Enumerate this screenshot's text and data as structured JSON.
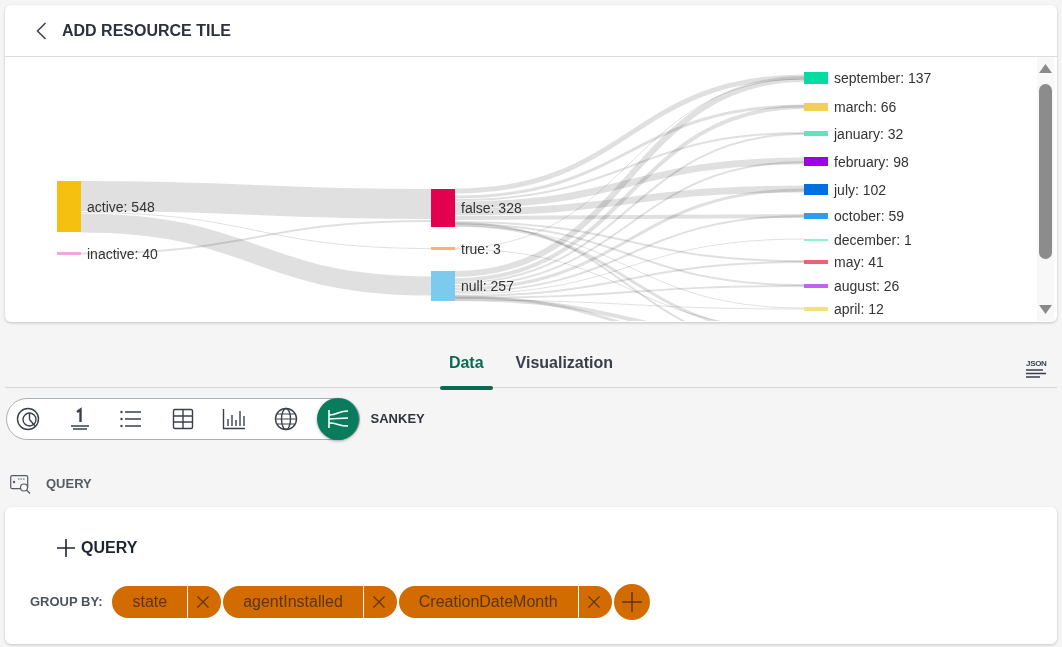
{
  "header": {
    "title": "ADD RESOURCE TILE"
  },
  "sankey": {
    "columns": [
      {
        "nodes": [
          {
            "label": "active: 548",
            "color": "#f5c00f"
          },
          {
            "label": "inactive: 40",
            "color": "#f2a6e8"
          }
        ]
      },
      {
        "nodes": [
          {
            "label": "false: 328",
            "color": "#e2004f"
          },
          {
            "label": "true: 3",
            "color": "#f6b27e"
          },
          {
            "label": "null: 257",
            "color": "#7ccbef"
          }
        ]
      },
      {
        "nodes": [
          {
            "label": "september: 137",
            "color": "#05dca0"
          },
          {
            "label": "march: 66",
            "color": "#f3d055"
          },
          {
            "label": "january: 32",
            "color": "#5ee5bd"
          },
          {
            "label": "february: 98",
            "color": "#9b00e8"
          },
          {
            "label": "july: 102",
            "color": "#0070e0"
          },
          {
            "label": "october: 59",
            "color": "#2ba0ee"
          },
          {
            "label": "december: 1",
            "color": "#8ff0d0"
          },
          {
            "label": "may: 41",
            "color": "#ef6078"
          },
          {
            "label": "august: 26",
            "color": "#c462ee"
          },
          {
            "label": "april: 12",
            "color": "#f5e07f"
          }
        ]
      }
    ]
  },
  "tabs": [
    {
      "label": "Data",
      "selected": true
    },
    {
      "label": "Visualization",
      "selected": false
    }
  ],
  "json_button": {
    "label": "JSON"
  },
  "chart_types": {
    "options": [
      {
        "kind": "pie",
        "selected": false
      },
      {
        "kind": "number",
        "selected": false
      },
      {
        "kind": "list",
        "selected": false
      },
      {
        "kind": "table",
        "selected": false
      },
      {
        "kind": "bar",
        "selected": false
      },
      {
        "kind": "map",
        "selected": false
      },
      {
        "kind": "sankey",
        "selected": true
      }
    ],
    "current_label": "SANKEY"
  },
  "query_section": {
    "label": "QUERY"
  },
  "query_card": {
    "add_query": "QUERY",
    "group_by": {
      "label": "GROUP BY:",
      "chips": [
        "state",
        "agentInstalled",
        "CreationDateMonth"
      ]
    }
  }
}
